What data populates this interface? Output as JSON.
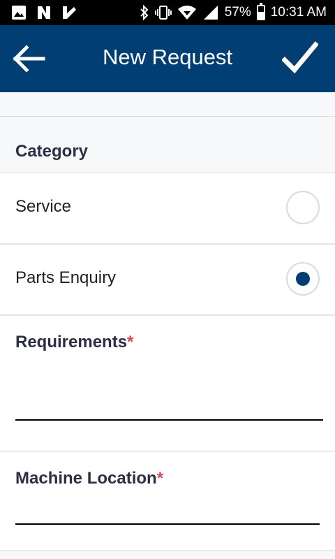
{
  "status_bar": {
    "battery_percent": "57%",
    "battery_level": 0.57,
    "time": "10:31 AM",
    "left_icons": [
      "image-icon",
      "n-app-icon",
      "checkmark-app-icon"
    ],
    "right_icons": [
      "bluetooth-icon",
      "vibrate-icon",
      "wifi-icon",
      "signal-icon",
      "battery-icon"
    ]
  },
  "app_bar": {
    "title": "New Request",
    "background": "#003e74",
    "back_icon": "arrow-left-icon",
    "confirm_icon": "check-icon"
  },
  "category": {
    "header": "Category",
    "options": [
      {
        "label": "Service",
        "selected": false
      },
      {
        "label": "Parts Enquiry",
        "selected": true
      }
    ]
  },
  "requirements": {
    "label": "Requirements",
    "required_marker": "*",
    "value": "",
    "placeholder": ""
  },
  "machine_location": {
    "label": "Machine Location",
    "required_marker": "*",
    "value": "",
    "placeholder": ""
  },
  "colors": {
    "accent": "#003e74",
    "required": "#e0434f",
    "label_text": "#2b2f45"
  }
}
